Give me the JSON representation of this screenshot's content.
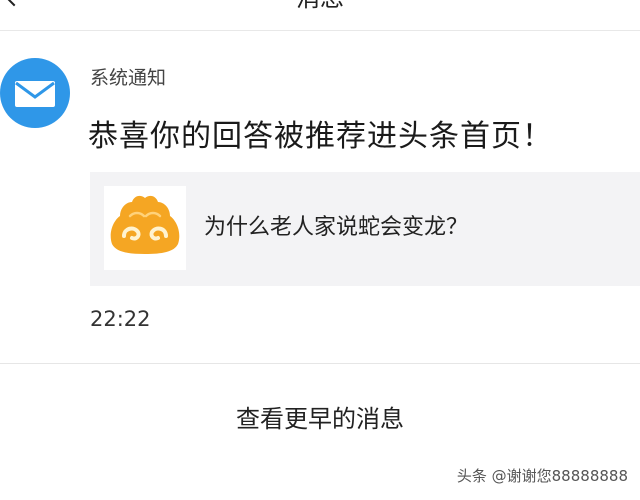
{
  "header": {
    "title": "消息"
  },
  "notification": {
    "sender": "系统通知",
    "message": "恭喜你的回答被推荐进头条首页！",
    "card": {
      "icon": "wukong-logo-icon",
      "title": "为什么老人家说蛇会变龙？"
    },
    "time": "22:22"
  },
  "footer": {
    "more_label": "查看更早的消息"
  },
  "watermark": "头条 @谢谢您88888888",
  "colors": {
    "avatar": "#2f97e8",
    "card_bg": "#f3f3f5",
    "logo": "#f5a623"
  }
}
